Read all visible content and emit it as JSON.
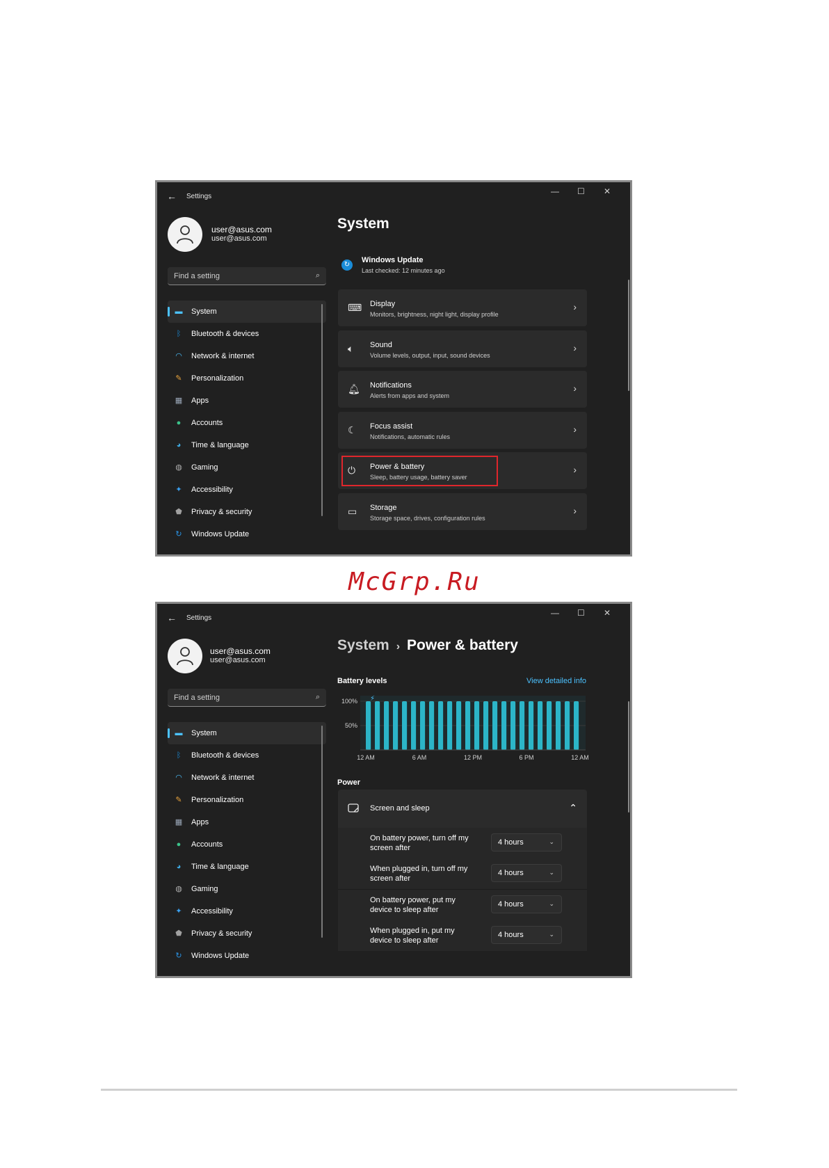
{
  "watermark": "McGrp.Ru",
  "common": {
    "app_title": "Settings",
    "user_name": "user@asus.com",
    "user_email": "user@asus.com",
    "search_placeholder": "Find a setting",
    "nav": [
      {
        "label": "System",
        "icon": "monitor-icon",
        "color": "#4cc2ff",
        "selected": true
      },
      {
        "label": "Bluetooth & devices",
        "icon": "bluetooth-icon",
        "color": "#1a8cd8"
      },
      {
        "label": "Network & internet",
        "icon": "wifi-icon",
        "color": "#4cc2ff"
      },
      {
        "label": "Personalization",
        "icon": "brush-icon",
        "color": "#e8a33d"
      },
      {
        "label": "Apps",
        "icon": "apps-icon",
        "color": "#9aa7b8"
      },
      {
        "label": "Accounts",
        "icon": "person-icon",
        "color": "#3bc28a"
      },
      {
        "label": "Time & language",
        "icon": "globe-icon",
        "color": "#3ea8e0"
      },
      {
        "label": "Gaming",
        "icon": "gamepad-icon",
        "color": "#b0b0b0"
      },
      {
        "label": "Accessibility",
        "icon": "accessibility-icon",
        "color": "#3aa0f0"
      },
      {
        "label": "Privacy & security",
        "icon": "shield-icon",
        "color": "#a0a0a0"
      },
      {
        "label": "Windows Update",
        "icon": "update-icon",
        "color": "#2a95e8"
      }
    ]
  },
  "window1": {
    "page_title": "System",
    "windows_update": {
      "title": "Windows Update",
      "subtitle": "Last checked: 12 minutes ago"
    },
    "cards": [
      {
        "title": "Display",
        "subtitle": "Monitors, brightness, night light, display profile",
        "icon": "laptop-icon"
      },
      {
        "title": "Sound",
        "subtitle": "Volume levels, output, input, sound devices",
        "icon": "speaker-icon"
      },
      {
        "title": "Notifications",
        "subtitle": "Alerts from apps and system",
        "icon": "bell-icon"
      },
      {
        "title": "Focus assist",
        "subtitle": "Notifications, automatic rules",
        "icon": "moon-icon"
      },
      {
        "title": "Power & battery",
        "subtitle": "Sleep, battery usage, battery saver",
        "icon": "power-icon",
        "highlighted": true
      },
      {
        "title": "Storage",
        "subtitle": "Storage space, drives, configuration rules",
        "icon": "drive-icon"
      }
    ]
  },
  "window2": {
    "breadcrumb_parent": "System",
    "breadcrumb_sep": "›",
    "breadcrumb_current": "Power & battery",
    "battery_levels_title": "Battery levels",
    "view_detailed_info": "View detailed info",
    "power_title": "Power",
    "screen_and_sleep": "Screen and sleep",
    "settings": [
      {
        "label_line1": "On battery power, turn off my",
        "label_line2": "screen after",
        "value": "4 hours"
      },
      {
        "label_line1": "When plugged in, turn off my",
        "label_line2": "screen after",
        "value": "4 hours"
      },
      {
        "label_line1": "On battery power, put my",
        "label_line2": "device to sleep after",
        "value": "4 hours"
      },
      {
        "label_line1": "When plugged in, put my",
        "label_line2": "device to sleep after",
        "value": "4 hours"
      }
    ]
  },
  "chart_data": {
    "type": "bar",
    "title": "Battery levels",
    "y_tick_labels": [
      "100%",
      "50%"
    ],
    "x_tick_labels": [
      "12 AM",
      "6 AM",
      "12 PM",
      "6 PM",
      "12 AM"
    ],
    "values": [
      100,
      100,
      100,
      100,
      100,
      100,
      100,
      100,
      100,
      100,
      100,
      100,
      100,
      100,
      100,
      100,
      100,
      100,
      100,
      100,
      100,
      100,
      100,
      100
    ],
    "ylim": [
      0,
      100
    ],
    "bar_color": "#2cb5c8",
    "plug_icon": "plug-icon"
  }
}
